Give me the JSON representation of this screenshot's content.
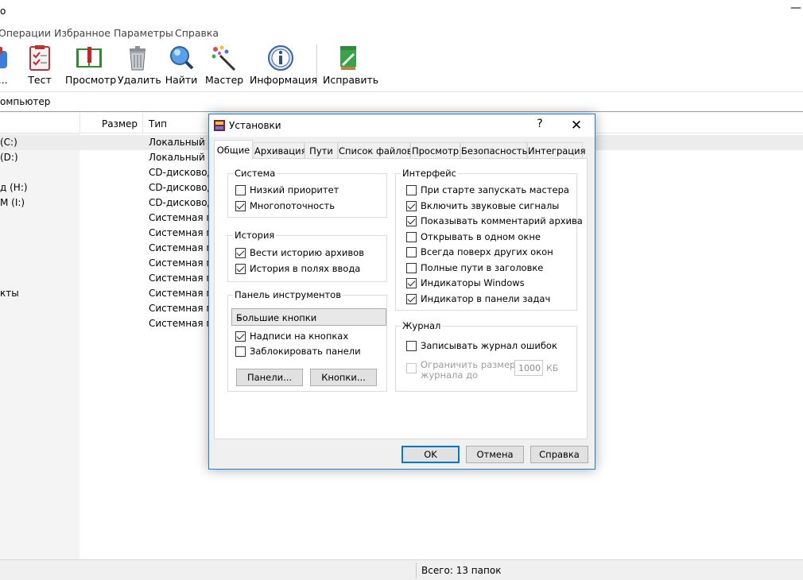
{
  "window": {
    "title_fragment": "o",
    "minimize_glyph": "—"
  },
  "menu": [
    "Операции",
    "Избранное",
    "Параметры",
    "Справка"
  ],
  "toolbar": [
    {
      "label": "ь...",
      "icon": "add-archive-icon"
    },
    {
      "label": "Тест",
      "icon": "test-icon"
    },
    {
      "label": "Просмотр",
      "icon": "view-book-icon"
    },
    {
      "label": "Удалить",
      "icon": "trash-icon"
    },
    {
      "label": "Найти",
      "icon": "magnifier-icon"
    },
    {
      "label": "Мастер",
      "icon": "wizard-wand-icon"
    },
    {
      "label": "Информация",
      "icon": "info-icon"
    },
    {
      "label": "Исправить",
      "icon": "repair-icon"
    }
  ],
  "address": "омпьютер",
  "filelist": {
    "columns": {
      "size": "Размер",
      "type": "Тип"
    },
    "rows": [
      {
        "name": "(C:)",
        "type": "Локальный ди"
      },
      {
        "name": "(D:)",
        "type": "Локальный ди"
      },
      {
        "name": "",
        "type": "CD-дисковод"
      },
      {
        "name": "д (H:)",
        "type": "CD-дисковод"
      },
      {
        "name": "M (I:)",
        "type": "CD-дисковод"
      },
      {
        "name": "",
        "type": "Системная па"
      },
      {
        "name": "",
        "type": "Системная па"
      },
      {
        "name": "",
        "type": "Системная па"
      },
      {
        "name": "",
        "type": "Системная па"
      },
      {
        "name": "",
        "type": "Системная па"
      },
      {
        "name": "кты",
        "type": "Системная па"
      },
      {
        "name": "",
        "type": "Системная па"
      },
      {
        "name": "",
        "type": "Системная па"
      }
    ]
  },
  "status": "Всего: 13 папок",
  "dialog": {
    "title": "Установки",
    "help": "?",
    "close": "✕",
    "tabs": [
      "Общие",
      "Архивация",
      "Пути",
      "Список файлов",
      "Просмотр",
      "Безопасность",
      "Интеграция"
    ],
    "active_tab": "Общие",
    "groups": {
      "system": {
        "title": "Система",
        "items": [
          {
            "label": "Низкий приоритет",
            "checked": false
          },
          {
            "label": "Многопоточность",
            "checked": true
          }
        ]
      },
      "history": {
        "title": "История",
        "items": [
          {
            "label": "Вести историю архивов",
            "checked": true
          },
          {
            "label": "История в полях ввода",
            "checked": true
          }
        ]
      },
      "toolbar_panel": {
        "title": "Панель инструментов",
        "combo_value": "Большие кнопки",
        "items": [
          {
            "label": "Надписи на кнопках",
            "checked": true
          },
          {
            "label": "Заблокировать панели",
            "checked": false
          }
        ],
        "panels_button": "Панели...",
        "buttons_button": "Кнопки..."
      },
      "interface": {
        "title": "Интерфейс",
        "items": [
          {
            "label": "При старте запускать мастера",
            "checked": false
          },
          {
            "label": "Включить звуковые сигналы",
            "checked": true
          },
          {
            "label": "Показывать комментарий архива",
            "checked": true
          },
          {
            "label": "Открывать в одном окне",
            "checked": false
          },
          {
            "label": "Всегда поверх других окон",
            "checked": false
          },
          {
            "label": "Полные пути в заголовке",
            "checked": false
          },
          {
            "label": "Индикаторы Windows",
            "checked": true
          },
          {
            "label": "Индикатор в панели задач",
            "checked": true
          }
        ]
      },
      "log": {
        "title": "Журнал",
        "items": [
          {
            "label": "Записывать журнал ошибок",
            "checked": false
          }
        ],
        "limit_label_1": "Ограничить размер",
        "limit_label_2": "журнала до",
        "limit_value": "1000",
        "limit_unit": "КБ"
      }
    },
    "buttons": {
      "ok": "OK",
      "cancel": "Отмена",
      "help": "Справка"
    }
  }
}
